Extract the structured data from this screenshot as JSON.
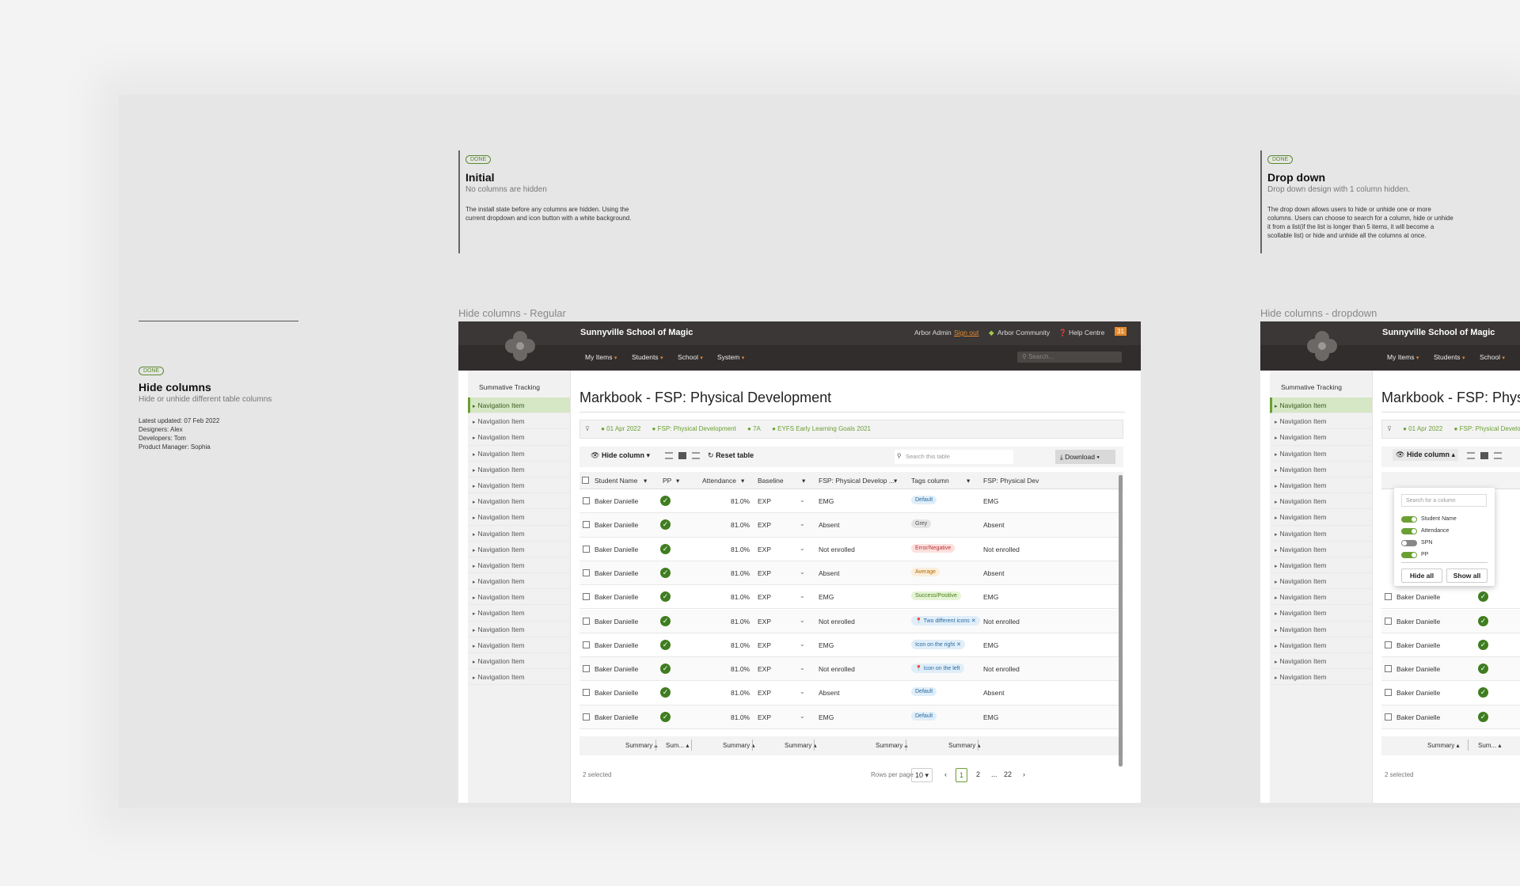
{
  "overview": {
    "badge": "DONE",
    "title": "Hide columns",
    "subtitle": "Hide or unhide different table columns",
    "meta": [
      "Latest updated: 07 Feb 2022",
      "Designers: Alex",
      "Developers: Tom",
      "Product Manager: Sophia"
    ]
  },
  "card_initial": {
    "badge": "DONE",
    "title": "Initial",
    "subtitle": "No columns are hidden",
    "body": "The install state before any columns are hidden. Using the current dropdown and icon button with a white background."
  },
  "card_dropdown": {
    "badge": "DONE",
    "title": "Drop down",
    "subtitle": "Drop down design with 1 column hidden.",
    "body": "The drop down allows users to hide or unhide one or more columns. Users can choose to search for a column, hide or unhide it from a list(if the list is longer than 5 items, it will become a scollable list) or hide and unhide all the columns at once."
  },
  "frame_labels": {
    "regular": "Hide columns - Regular",
    "dropdown": "Hide columns - dropdown"
  },
  "app": {
    "school": "Sunnyville School of Magic",
    "user": "Arbor Admin",
    "sign_out": "Sign out",
    "community": "Arbor Community",
    "help": "Help Centre",
    "notif_count": "31",
    "menus": [
      "My Items",
      "Students",
      "School",
      "System"
    ],
    "search_placeholder": "Search..."
  },
  "sidebar": {
    "title": "Summative Tracking",
    "item_label": "Navigation Item",
    "count": 18
  },
  "page": {
    "title": "Markbook - FSP: Physical Development",
    "filters": [
      "01 Apr 2022",
      "FSP: Physical Development",
      "7A",
      "EYFS Early Learning Goals 2021"
    ],
    "hide_column": "Hide column",
    "reset": "Reset table",
    "table_search": "Search this table",
    "download": "Download"
  },
  "table": {
    "headers": [
      "Student Name",
      "PP",
      "Attendance",
      "Baseline",
      "FSP: Physical Develop ...",
      "Tags column",
      "FSP: Physical Dev"
    ],
    "rows": [
      {
        "name": "Baker Danielle",
        "att": "81.0%",
        "base": "EXP",
        "fsp": "EMG",
        "tag": "Default",
        "tagtype": "default",
        "last": "EMG"
      },
      {
        "name": "Baker Danielle",
        "att": "81.0%",
        "base": "EXP",
        "fsp": "Absent",
        "tag": "Grey",
        "tagtype": "grey",
        "last": "Absent"
      },
      {
        "name": "Baker Danielle",
        "att": "81.0%",
        "base": "EXP",
        "fsp": "Not enrolled",
        "tag": "Error/Negative",
        "tagtype": "error",
        "last": "Not enrolled"
      },
      {
        "name": "Baker Danielle",
        "att": "81.0%",
        "base": "EXP",
        "fsp": "Absent",
        "tag": "Average",
        "tagtype": "average",
        "last": "Absent"
      },
      {
        "name": "Baker Danielle",
        "att": "81.0%",
        "base": "EXP",
        "fsp": "EMG",
        "tag": "Success/Positive",
        "tagtype": "success",
        "last": "EMG"
      },
      {
        "name": "Baker Danielle",
        "att": "81.0%",
        "base": "EXP",
        "fsp": "Not enrolled",
        "tag": "Two different icons",
        "tagtype": "info",
        "last": "Not enrolled"
      },
      {
        "name": "Baker Danielle",
        "att": "81.0%",
        "base": "EXP",
        "fsp": "EMG",
        "tag": "Icon on the right",
        "tagtype": "info",
        "last": "EMG"
      },
      {
        "name": "Baker Danielle",
        "att": "81.0%",
        "base": "EXP",
        "fsp": "Not enrolled",
        "tag": "Icon on the left",
        "tagtype": "info",
        "last": "Not enrolled"
      },
      {
        "name": "Baker Danielle",
        "att": "81.0%",
        "base": "EXP",
        "fsp": "Absent",
        "tag": "Default",
        "tagtype": "default",
        "last": "Absent"
      },
      {
        "name": "Baker Danielle",
        "att": "81.0%",
        "base": "EXP",
        "fsp": "EMG",
        "tag": "Default",
        "tagtype": "default",
        "last": "EMG"
      }
    ],
    "summary_labels": [
      "Summary",
      "Sum...",
      "Summary",
      "Summary",
      "Summary",
      "Summary"
    ]
  },
  "pager": {
    "selected": "2 selected",
    "rows_per_page_label": "Rows per page",
    "rows_per_page": "10",
    "pages": [
      "1",
      "2",
      "...",
      "22"
    ]
  },
  "dropdown": {
    "search_placeholder": "Search for a column",
    "columns": [
      {
        "label": "Student Name",
        "on": true
      },
      {
        "label": "Attendance",
        "on": true
      },
      {
        "label": "SPN",
        "on": false
      },
      {
        "label": "PP",
        "on": true
      }
    ],
    "hide_all": "Hide all",
    "show_all": "Show all"
  },
  "colors": {
    "accent": "#6aa033",
    "topbar": "#3a3736",
    "notif": "#e58a2b"
  }
}
